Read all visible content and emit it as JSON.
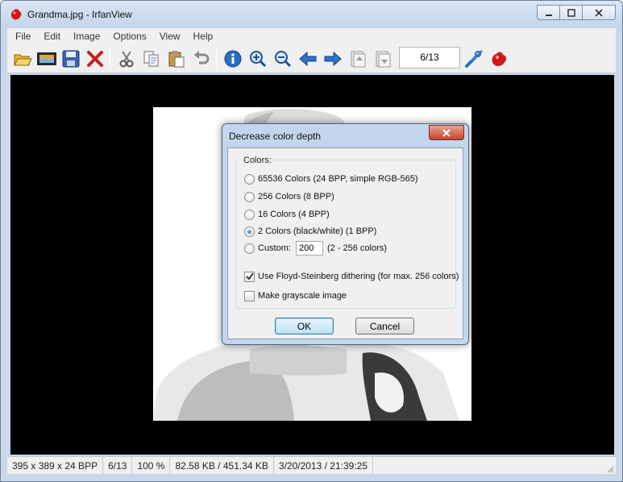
{
  "window": {
    "title": "Grandma.jpg - IrfanView",
    "menu": [
      "File",
      "Edit",
      "Image",
      "Options",
      "View",
      "Help"
    ],
    "page_counter": "6/13"
  },
  "toolbar_icons": [
    "open-folder-icon",
    "slideshow-icon",
    "save-icon",
    "delete-icon",
    "cut-icon",
    "copy-icon",
    "paste-icon",
    "undo-icon",
    "info-icon",
    "zoom-in-icon",
    "zoom-out-icon",
    "previous-icon",
    "next-icon",
    "first-page-icon",
    "last-page-icon",
    "settings-icon",
    "irfanview-logo-icon"
  ],
  "status": {
    "dimensions": "395 x 389 x 24 BPP",
    "page": "6/13",
    "zoom": "100 %",
    "size": "82.58 KB / 451.34 KB",
    "datetime": "3/20/2013 / 21:39:25"
  },
  "dialog": {
    "title": "Decrease color depth",
    "group_label": "Colors:",
    "options": [
      {
        "label": "65536 Colors (24 BPP, simple RGB-565)",
        "checked": false
      },
      {
        "label": "256 Colors (8 BPP)",
        "checked": false
      },
      {
        "label": "16 Colors (4 BPP)",
        "checked": false
      },
      {
        "label": "2 Colors (black/white) (1 BPP)",
        "checked": true
      },
      {
        "label": "Custom:",
        "checked": false
      }
    ],
    "custom_value": "200",
    "custom_hint": "(2 - 256 colors)",
    "dither_label": "Use Floyd-Steinberg dithering (for max. 256 colors)",
    "dither_checked": true,
    "grayscale_label": "Make grayscale image",
    "grayscale_checked": false,
    "ok_label": "OK",
    "cancel_label": "Cancel"
  },
  "colors": {
    "viewer_bg": "#000000",
    "window_frame": "#c9d8ea",
    "accent": "#1a5fa8"
  }
}
